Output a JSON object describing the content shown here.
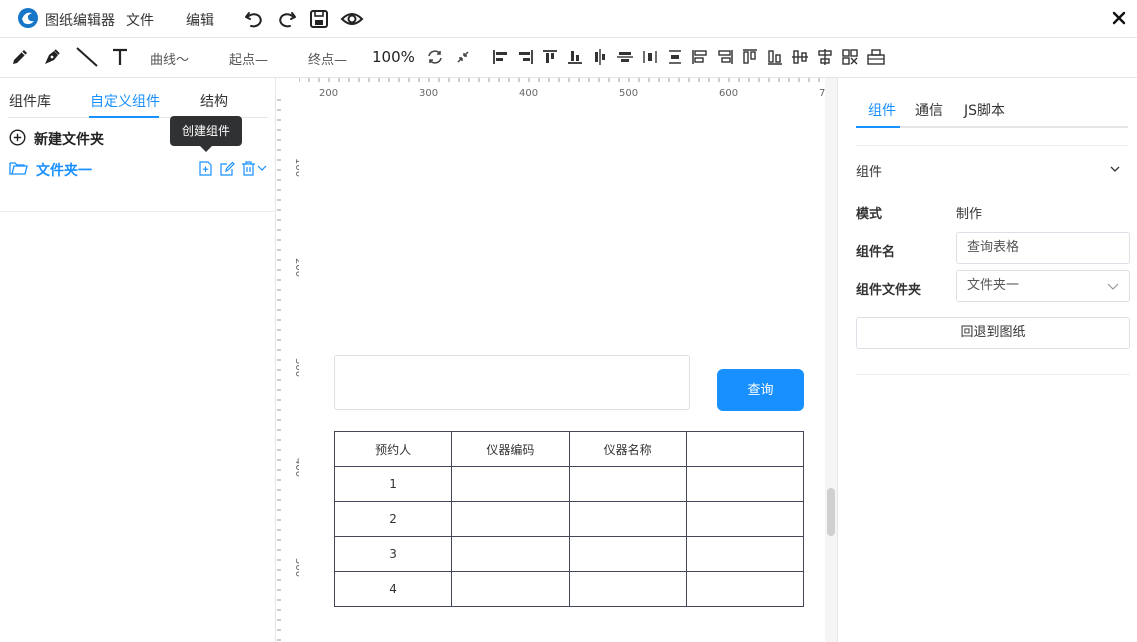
{
  "app": {
    "title": "图纸编辑器"
  },
  "menu": {
    "file": "文件",
    "edit": "编辑"
  },
  "toolbar": {
    "curve": "曲线～",
    "start_point": "起点—",
    "end_point": "终点—",
    "zoom": "100%"
  },
  "left_panel": {
    "tabs": [
      {
        "label": "组件库"
      },
      {
        "label": "自定义组件"
      },
      {
        "label": "结构"
      }
    ],
    "active_tab": 1,
    "new_folder": "新建文件夹",
    "tooltip": "创建组件",
    "folder": "文件夹一"
  },
  "ruler": {
    "top_labels": [
      "200",
      "300",
      "400",
      "500",
      "600",
      "7"
    ],
    "left_labels": [
      "100",
      "200",
      "300",
      "400",
      "500"
    ]
  },
  "canvas": {
    "query_button": "查询",
    "table": {
      "headers": [
        "预约人",
        "仪器编码",
        "仪器名称",
        ""
      ],
      "rows": [
        [
          "1",
          "",
          "",
          ""
        ],
        [
          "2",
          "",
          "",
          ""
        ],
        [
          "3",
          "",
          "",
          ""
        ],
        [
          "4",
          "",
          "",
          ""
        ]
      ]
    }
  },
  "right_panel": {
    "tabs": [
      {
        "label": "组件"
      },
      {
        "label": "通信"
      },
      {
        "label": "JS脚本"
      }
    ],
    "section_title": "组件",
    "mode_label": "模式",
    "mode_value": "制作",
    "name_label": "组件名",
    "name_value": "查询表格",
    "folder_label": "组件文件夹",
    "folder_value": "文件夹一",
    "back_button": "回退到图纸"
  },
  "colors": {
    "accent": "#1890ff",
    "tooltip_bg": "#303133",
    "table_border": "#44475a"
  }
}
